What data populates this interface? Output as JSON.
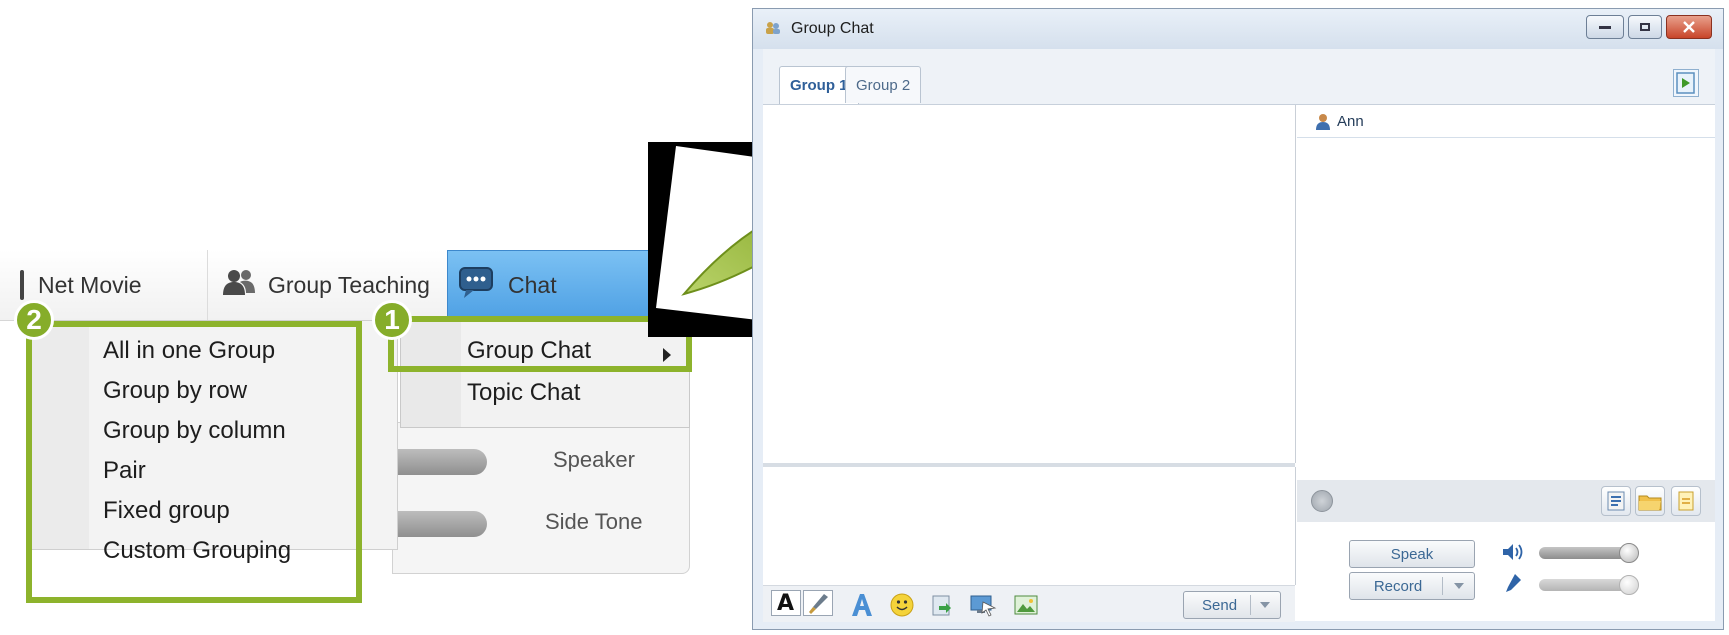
{
  "toolbar": {
    "net_movie": "Net Movie",
    "group_teaching": "Group Teaching",
    "chat": "Chat"
  },
  "chat_menu": {
    "items": [
      "Group Chat",
      "Topic Chat"
    ]
  },
  "group_menu": {
    "items": [
      "All in one Group",
      "Group by row",
      "Group by column",
      "Pair",
      "Fixed group",
      "Custom Grouping"
    ]
  },
  "audio_panel": {
    "speaker": "Speaker",
    "side_tone": "Side Tone"
  },
  "callouts": {
    "step1": "1",
    "step2": "2"
  },
  "window": {
    "title": "Group Chat",
    "tabs": [
      "Group 1",
      "Group 2"
    ],
    "active_tab": "Group 1",
    "users": [
      "Ann"
    ],
    "send_label": "Send",
    "speak_label": "Speak",
    "record_label": "Record"
  },
  "icons": {
    "group_teaching": "people-icon",
    "chat": "chat-bubble-icon",
    "submenu_arrow": "triangle-right-icon",
    "big_arrow": "green-arrow-icon"
  },
  "colors": {
    "callout_green": "#8db32c",
    "chat_blue": "#4ea0e4",
    "window_frame": "#8a9bb0",
    "arrow_green": "#8aae28"
  }
}
